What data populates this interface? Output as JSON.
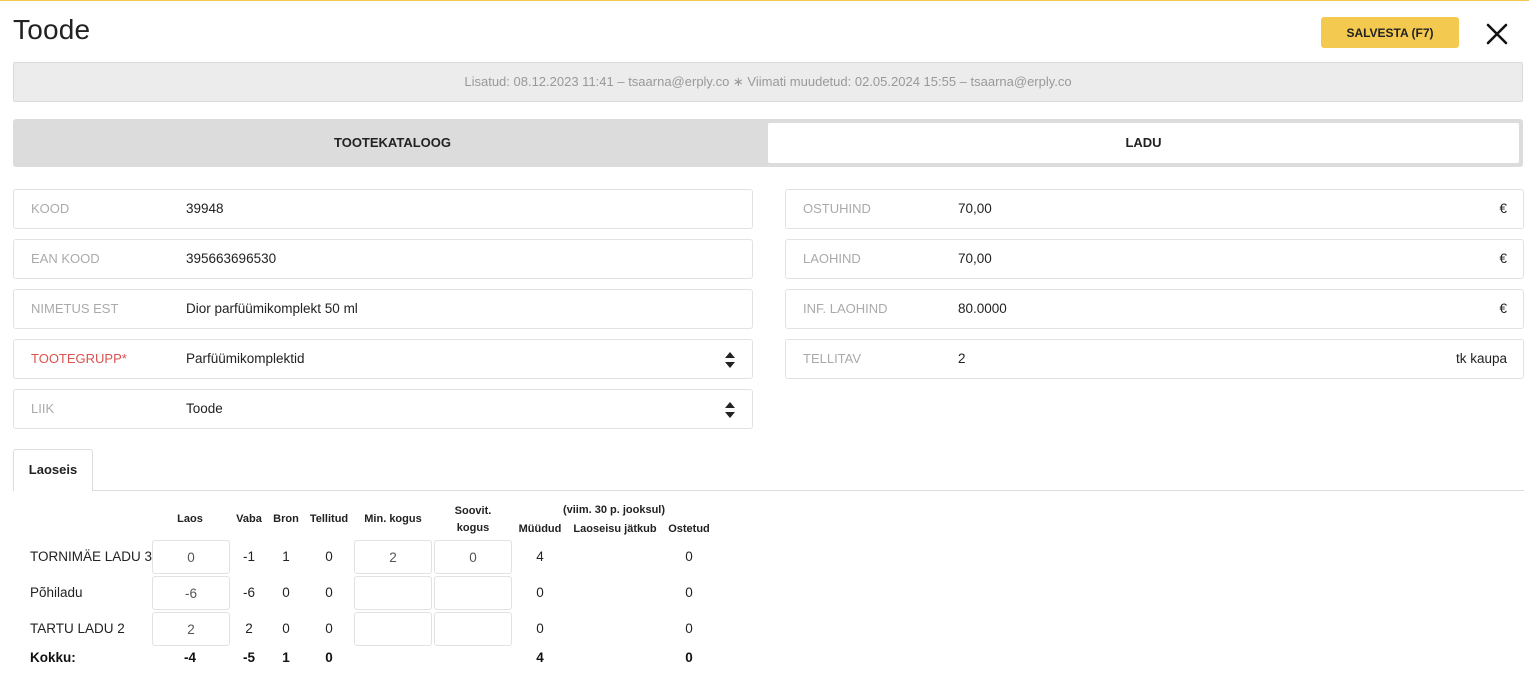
{
  "header": {
    "title": "Toode",
    "save_label": "SALVESTA (F7)",
    "meta": "Lisatud:  08.12.2023 11:41 – tsaarna@erply.co  ∗  Viimati muudetud: 02.05.2024 15:55 – tsaarna@erply.co"
  },
  "tabs": [
    {
      "label": "TOOTEKATALOOG",
      "active": false
    },
    {
      "label": "LADU",
      "active": true
    }
  ],
  "left_fields": [
    {
      "label": "KOOD",
      "value": "39948"
    },
    {
      "label": "EAN KOOD",
      "value": "395663696530"
    },
    {
      "label": "NIMETUS EST",
      "value": "Dior parfüümikomplekt 50 ml"
    },
    {
      "label": "TOOTEGRUPP*",
      "value": "Parfüümikomplektid",
      "required": true,
      "select": true
    },
    {
      "label": "LIIK",
      "value": "Toode",
      "select": true
    }
  ],
  "right_fields": [
    {
      "label": "OSTUHIND",
      "value": "70,00",
      "suffix": "€"
    },
    {
      "label": "LAOHIND",
      "value": "70,00",
      "suffix": "€"
    },
    {
      "label": "INF. LAOHIND",
      "value": "80.0000",
      "suffix": "€"
    },
    {
      "label": "TELLITAV",
      "value": "2",
      "suffix": "tk kaupa"
    }
  ],
  "stock": {
    "tab_label": "Laoseis",
    "headers": {
      "laos": "Laos",
      "vaba": "Vaba",
      "bron": "Bron",
      "tellitud": "Tellitud",
      "min_kogus": "Min. kogus",
      "soovit_1": "Soovit.",
      "soovit_2": "kogus",
      "period": "(viim. 30 p. jooksul)",
      "muudud": "Müüdud",
      "laoseisu_jatkub": "Laoseisu jätkub",
      "ostetud": "Ostetud"
    },
    "rows": [
      {
        "name": "TORNIMÄE LADU 3",
        "laos": "0",
        "vaba": "-1",
        "bron": "1",
        "tellitud": "0",
        "min_kogus": "2",
        "soovit": "0",
        "muudud": "4",
        "laoseisu_jatkub": "",
        "ostetud": "0"
      },
      {
        "name": "Põhiladu",
        "laos": "-6",
        "vaba": "-6",
        "bron": "0",
        "tellitud": "0",
        "min_kogus": "",
        "soovit": "",
        "muudud": "0",
        "laoseisu_jatkub": "",
        "ostetud": "0"
      },
      {
        "name": "TARTU LADU 2",
        "laos": "2",
        "vaba": "2",
        "bron": "0",
        "tellitud": "0",
        "min_kogus": "",
        "soovit": "",
        "muudud": "0",
        "laoseisu_jatkub": "",
        "ostetud": "0"
      }
    ],
    "total": {
      "name": "Kokku:",
      "laos": "-4",
      "vaba": "-5",
      "bron": "1",
      "tellitud": "0",
      "muudud": "4",
      "ostetud": "0"
    }
  }
}
